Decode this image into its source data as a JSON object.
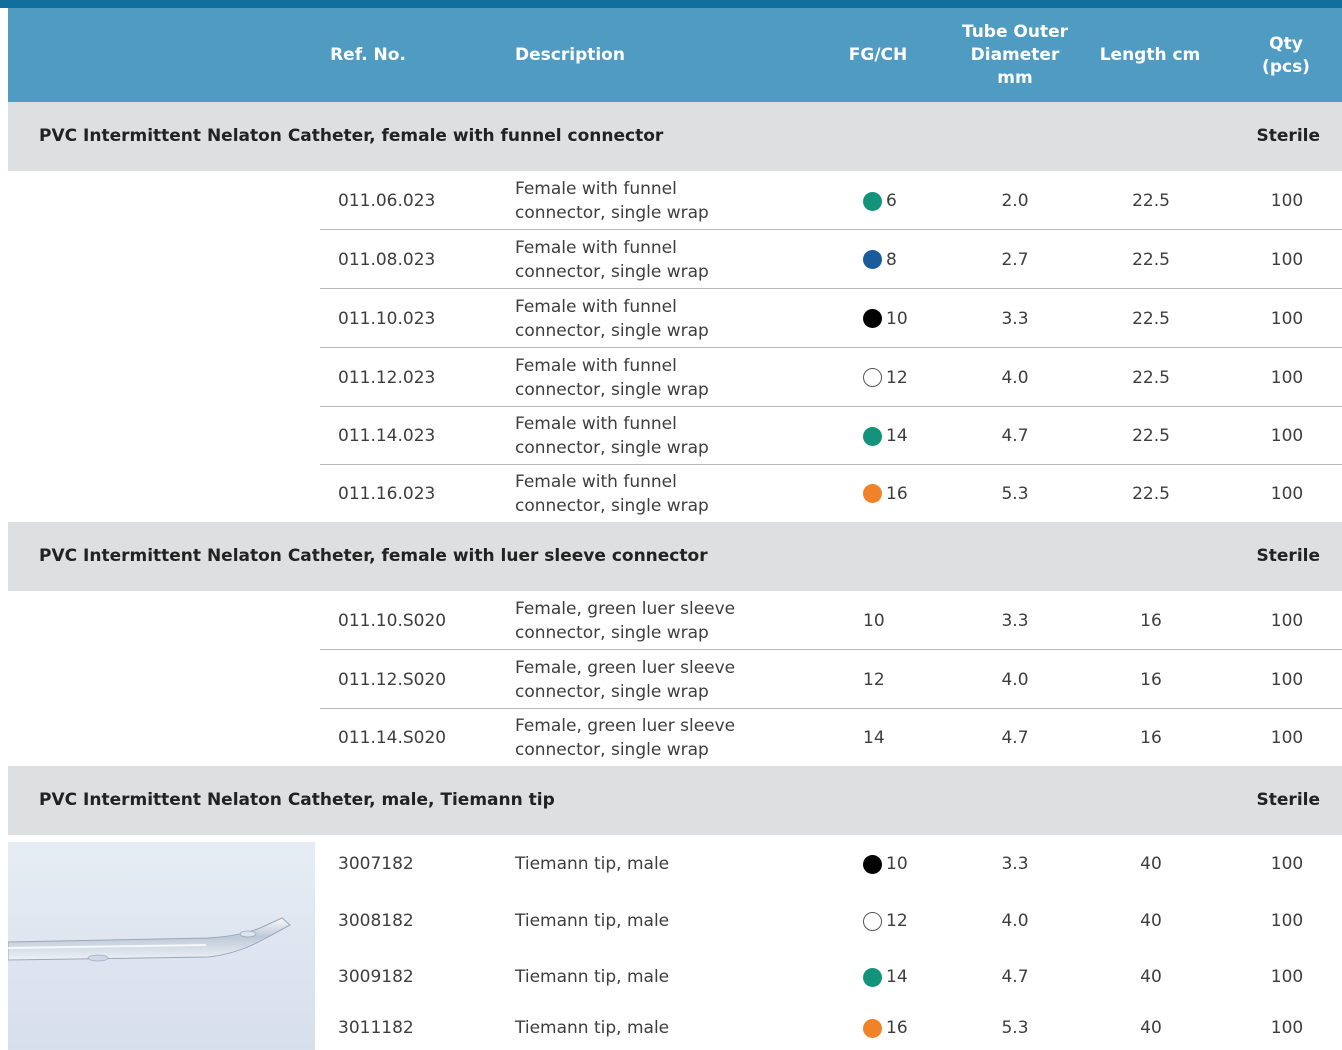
{
  "header": {
    "ref": "Ref. No.",
    "desc": "Description",
    "fg": "FG/CH",
    "od_line1": "Tube Outer",
    "od_line2": "Diameter",
    "od_line3": "mm",
    "len": "Length cm",
    "qty_line1": "Qty",
    "qty_line2": "(pcs)"
  },
  "sections": [
    {
      "title": "PVC Intermittent Nelaton Catheter, female with funnel connector",
      "tag": "Sterile",
      "rows": [
        {
          "ref": "011.06.023",
          "desc1": "Female with funnel",
          "desc2": "connector, single wrap",
          "fg": "6",
          "dot": "#12937a",
          "od": "2.0",
          "len": "22.5",
          "qty": "100"
        },
        {
          "ref": "011.08.023",
          "desc1": "Female with funnel",
          "desc2": "connector, single wrap",
          "fg": "8",
          "dot": "#1a5b9c",
          "od": "2.7",
          "len": "22.5",
          "qty": "100"
        },
        {
          "ref": "011.10.023",
          "desc1": "Female with funnel",
          "desc2": "connector, single wrap",
          "fg": "10",
          "dot": "#000000",
          "od": "3.3",
          "len": "22.5",
          "qty": "100"
        },
        {
          "ref": "011.12.023",
          "desc1": "Female with funnel",
          "desc2": "connector, single wrap",
          "fg": "12",
          "dot": "#ffffff",
          "od": "4.0",
          "len": "22.5",
          "qty": "100"
        },
        {
          "ref": "011.14.023",
          "desc1": "Female with funnel",
          "desc2": "connector, single wrap",
          "fg": "14",
          "dot": "#12937a",
          "od": "4.7",
          "len": "22.5",
          "qty": "100"
        },
        {
          "ref": "011.16.023",
          "desc1": "Female with funnel",
          "desc2": "connector, single wrap",
          "fg": "16",
          "dot": "#f08229",
          "od": "5.3",
          "len": "22.5",
          "qty": "100"
        }
      ]
    },
    {
      "title": "PVC Intermittent Nelaton Catheter, female with luer sleeve connector",
      "tag": "Sterile",
      "rows": [
        {
          "ref": "011.10.S020",
          "desc1": "Female, green luer sleeve",
          "desc2": "connector, single wrap",
          "fg": "10",
          "od": "3.3",
          "len": "16",
          "qty": "100"
        },
        {
          "ref": "011.12.S020",
          "desc1": "Female, green luer sleeve",
          "desc2": "connector, single wrap",
          "fg": "12",
          "od": "4.0",
          "len": "16",
          "qty": "100"
        },
        {
          "ref": "011.14.S020",
          "desc1": "Female, green luer sleeve",
          "desc2": "connector, single wrap",
          "fg": "14",
          "od": "4.7",
          "len": "16",
          "qty": "100"
        }
      ]
    },
    {
      "title": "PVC Intermittent Nelaton Catheter, male, Tiemann tip",
      "tag": "Sterile",
      "rows": [
        {
          "ref": "3007182",
          "desc1": "Tiemann tip, male",
          "fg": "10",
          "dot": "#000000",
          "od": "3.3",
          "len": "40",
          "qty": "100"
        },
        {
          "ref": "3008182",
          "desc1": "Tiemann tip, male",
          "fg": "12",
          "dot": "#ffffff",
          "od": "4.0",
          "len": "40",
          "qty": "100"
        },
        {
          "ref": "3009182",
          "desc1": "Tiemann tip, male",
          "fg": "14",
          "dot": "#12937a",
          "od": "4.7",
          "len": "40",
          "qty": "100"
        },
        {
          "ref": "3011182",
          "desc1": "Tiemann tip, male",
          "fg": "16",
          "dot": "#f08229",
          "od": "5.3",
          "len": "40",
          "qty": "100"
        }
      ]
    }
  ]
}
